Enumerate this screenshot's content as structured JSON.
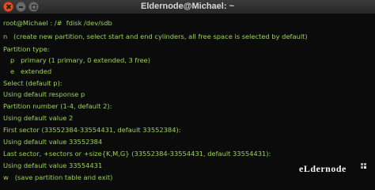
{
  "window": {
    "title": "Eldernode@Michael: ~"
  },
  "terminal": {
    "lines": [
      "root@Michael : /#  fdisk /dev/sdb",
      "n   (create new partition, select start and end cylinders, all free space is selected by default)",
      "Partition type:",
      "p   primary (1 primary, 0 extended, 3 free)",
      "e   extended",
      "Select (default p):",
      "Using default response p",
      "Partition number (1-4, default 2):",
      "Using default value 2",
      "First sector (33552384-33554431, default 33552384):",
      "Using default value 33552384",
      "Last sector, +sectors or +size{K,M,G} (33552384-33554431, default 33554431):",
      "Using default value 33554431",
      "w   (save partition table and exit)"
    ]
  },
  "watermark": {
    "text": "eLdernode",
    "icon": "eldernode-logo-icon"
  },
  "colors": {
    "terminal_text": "#9bd35a",
    "background": "#0b0b0b",
    "titlebar": "#2f2f2f"
  }
}
